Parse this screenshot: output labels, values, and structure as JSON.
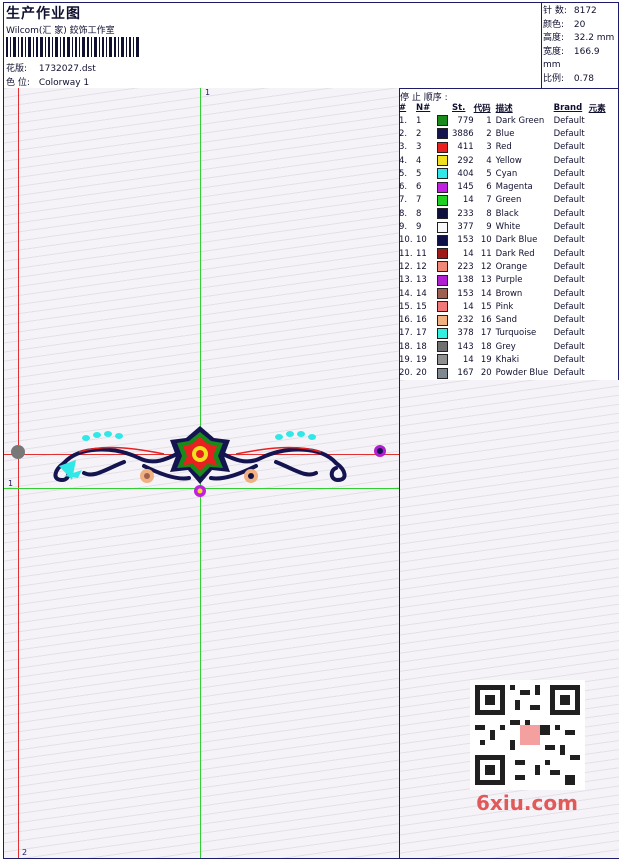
{
  "header": {
    "title": "生产作业图",
    "company": "Wilcom(汇 家) 鉸饰工作室",
    "design_label": "花版:",
    "design_value": "1732027.dst",
    "colorway_label": "色 位:",
    "colorway_value": "Colorway 1"
  },
  "stats": {
    "stitches_label": "针 数:",
    "stitches_value": "8172",
    "colors_label": "颜色:",
    "colors_value": "20",
    "height_label": "高度:",
    "height_value": "32.2 mm",
    "width_label": "宽度:",
    "width_value": "166.9 mm",
    "scale_label": "比例:",
    "scale_value": "0.78"
  },
  "guides": {
    "top_marker": "1",
    "left_marker": "1",
    "bottom_marker": "2"
  },
  "stop_sequence": {
    "title": "停 止 顺序 :",
    "headers": {
      "idx": "#",
      "n": "N#",
      "st": "St.",
      "code": "代码",
      "desc": "描述",
      "brand": "Brand",
      "element": "元素"
    },
    "rows": [
      {
        "idx": "1.",
        "n": "1",
        "color": "#1a8a1a",
        "st": "779",
        "code": "1",
        "desc": "Dark Green",
        "brand": "Default"
      },
      {
        "idx": "2.",
        "n": "2",
        "color": "#141450",
        "st": "3886",
        "code": "2",
        "desc": "Blue",
        "brand": "Default"
      },
      {
        "idx": "3.",
        "n": "3",
        "color": "#e82020",
        "st": "411",
        "code": "3",
        "desc": "Red",
        "brand": "Default"
      },
      {
        "idx": "4.",
        "n": "4",
        "color": "#f0e020",
        "st": "292",
        "code": "4",
        "desc": "Yellow",
        "brand": "Default"
      },
      {
        "idx": "5.",
        "n": "5",
        "color": "#30e8e8",
        "st": "404",
        "code": "5",
        "desc": "Cyan",
        "brand": "Default"
      },
      {
        "idx": "6.",
        "n": "6",
        "color": "#c020e0",
        "st": "145",
        "code": "6",
        "desc": "Magenta",
        "brand": "Default"
      },
      {
        "idx": "7.",
        "n": "7",
        "color": "#20d020",
        "st": "14",
        "code": "7",
        "desc": "Green",
        "brand": "Default"
      },
      {
        "idx": "8.",
        "n": "8",
        "color": "#101040",
        "st": "233",
        "code": "8",
        "desc": "Black",
        "brand": "Default"
      },
      {
        "idx": "9.",
        "n": "9",
        "color": "#f8f8f8",
        "st": "377",
        "code": "9",
        "desc": "White",
        "brand": "Default"
      },
      {
        "idx": "10.",
        "n": "10",
        "color": "#101048",
        "st": "153",
        "code": "10",
        "desc": "Dark Blue",
        "brand": "Default"
      },
      {
        "idx": "11.",
        "n": "11",
        "color": "#a01818",
        "st": "14",
        "code": "11",
        "desc": "Dark Red",
        "brand": "Default"
      },
      {
        "idx": "12.",
        "n": "12",
        "color": "#f08878",
        "st": "223",
        "code": "12",
        "desc": "Orange",
        "brand": "Default"
      },
      {
        "idx": "13.",
        "n": "13",
        "color": "#b020d0",
        "st": "138",
        "code": "13",
        "desc": "Purple",
        "brand": "Default"
      },
      {
        "idx": "14.",
        "n": "14",
        "color": "#a06050",
        "st": "153",
        "code": "14",
        "desc": "Brown",
        "brand": "Default"
      },
      {
        "idx": "15.",
        "n": "15",
        "color": "#f07878",
        "st": "14",
        "code": "15",
        "desc": "Pink",
        "brand": "Default"
      },
      {
        "idx": "16.",
        "n": "16",
        "color": "#f0b080",
        "st": "232",
        "code": "16",
        "desc": "Sand",
        "brand": "Default"
      },
      {
        "idx": "17.",
        "n": "17",
        "color": "#30f0e0",
        "st": "378",
        "code": "17",
        "desc": "Turquoise",
        "brand": "Default"
      },
      {
        "idx": "18.",
        "n": "18",
        "color": "#707070",
        "st": "143",
        "code": "18",
        "desc": "Grey",
        "brand": "Default"
      },
      {
        "idx": "19.",
        "n": "19",
        "color": "#909090",
        "st": "14",
        "code": "19",
        "desc": "Khaki",
        "brand": "Default"
      },
      {
        "idx": "20.",
        "n": "20",
        "color": "#808890",
        "st": "167",
        "code": "20",
        "desc": "Powder Blue",
        "brand": "Default"
      }
    ]
  },
  "watermark": "6xiu.com"
}
